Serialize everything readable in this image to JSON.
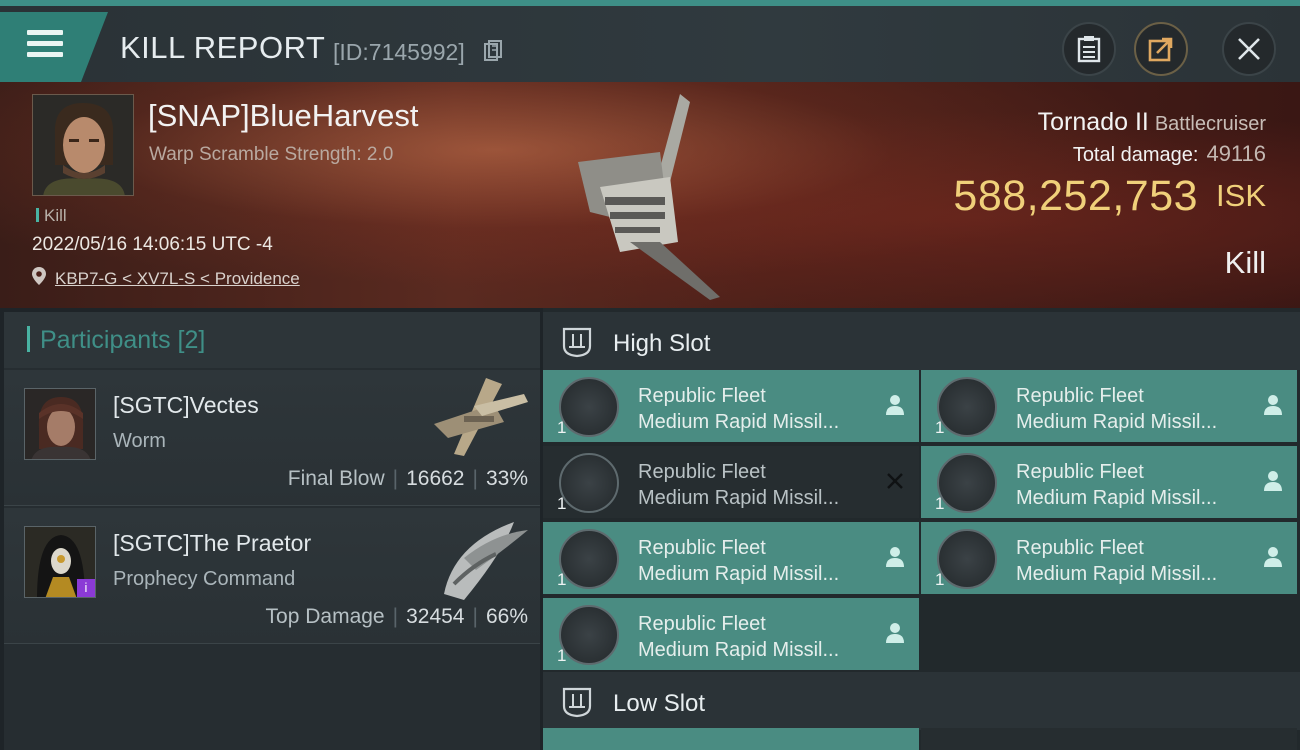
{
  "header": {
    "title": "KILL REPORT",
    "report_id": "[ID:7145992]"
  },
  "victim": {
    "name": "[SNAP]BlueHarvest",
    "subtitle": "Warp Scramble Strength: 2.0",
    "tag": "Kill",
    "datetime": "2022/05/16 14:06:15 UTC -4",
    "location": "KBP7-G < XV7L-S < Providence",
    "ship_name": "Tornado II",
    "ship_class": "Battlecruiser",
    "total_damage_label": "Total damage:",
    "total_damage": "49116",
    "isk_value": "588,252,753",
    "isk_unit": "ISK",
    "result": "Kill"
  },
  "participants": {
    "title": "Participants [2]",
    "list": [
      {
        "name": "[SGTC]Vectes",
        "ship": "Worm",
        "label": "Final Blow",
        "damage": "16662",
        "percent": "33%"
      },
      {
        "name": "[SGTC]The Praetor",
        "ship": "Prophecy Command",
        "label": "Top Damage",
        "damage": "32454",
        "percent": "66%"
      }
    ]
  },
  "fitting": {
    "high_slot_title": "High Slot",
    "low_slot_title": "Low Slot",
    "modules": [
      {
        "line1": "Republic Fleet",
        "line2": "Medium Rapid Missil...",
        "qty": "1",
        "status": "person-icon"
      },
      {
        "line1": "Republic Fleet",
        "line2": "Medium Rapid Missil...",
        "qty": "1",
        "status": "person-icon"
      },
      {
        "line1": "Republic Fleet",
        "line2": "Medium Rapid Missil...",
        "qty": "1",
        "status": "close-icon"
      },
      {
        "line1": "Republic Fleet",
        "line2": "Medium Rapid Missil...",
        "qty": "1",
        "status": "person-icon"
      },
      {
        "line1": "Republic Fleet",
        "line2": "Medium Rapid Missil...",
        "qty": "1",
        "status": "person-icon"
      },
      {
        "line1": "Republic Fleet",
        "line2": "Medium Rapid Missil...",
        "qty": "1",
        "status": "person-icon"
      },
      {
        "line1": "Republic Fleet",
        "line2": "Medium Rapid Missil...",
        "qty": "1",
        "status": "person-icon"
      }
    ]
  },
  "colors": {
    "accent": "#49b3a3",
    "module_bg": "#4a8c82",
    "isk": "#f0d07a"
  }
}
